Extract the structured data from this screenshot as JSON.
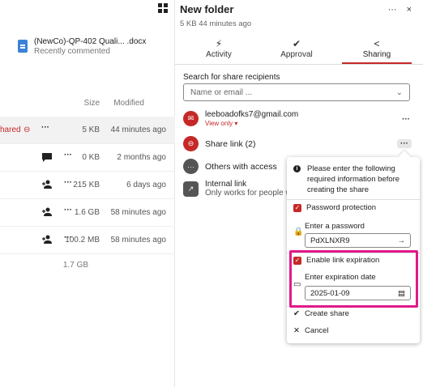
{
  "left": {
    "recent": {
      "name": "(NewCo)-QP-402 Quali... .docx",
      "status": "Recently commented"
    },
    "headers": {
      "size": "Size",
      "modified": "Modified"
    },
    "rows": [
      {
        "shared": "hared",
        "size": "5 KB",
        "modified": "44 minutes ago",
        "highlighted": true
      },
      {
        "size": "0 KB",
        "modified": "2 months ago"
      },
      {
        "size": "215 KB",
        "modified": "6 days ago"
      },
      {
        "size": "1.6 GB",
        "modified": "58 minutes ago"
      },
      {
        "size": "100.2 MB",
        "modified": "58 minutes ago"
      }
    ],
    "total": "1.7 GB"
  },
  "panel": {
    "title": "New folder",
    "subtitle": "5 KB 44 minutes ago",
    "more": "···",
    "close": "×",
    "tabs": [
      {
        "label": "Activity",
        "icon": "⚡"
      },
      {
        "label": "Approval",
        "icon": "✔"
      },
      {
        "label": "Sharing",
        "icon": "<"
      }
    ],
    "search_label": "Search for share recipients",
    "search_placeholder": "Name or email ...",
    "recipients": [
      {
        "name": "leeboadofks7@gmail.com",
        "perm": "View only ▾"
      },
      {
        "name": "Share link (2)"
      },
      {
        "name": "Others with access"
      },
      {
        "name": "Internal link",
        "sub": "Only works for people w"
      }
    ]
  },
  "popup": {
    "info": "Please enter the following required information before creating the share",
    "password_protection": "Password protection",
    "password_label": "Enter a password",
    "password_value": "PdXLNXR9",
    "enable_expiration": "Enable link expiration",
    "expiration_label": "Enter expiration date",
    "expiration_value": "2025-01-09",
    "create": "Create share",
    "cancel": "Cancel"
  },
  "colors": {
    "accent": "#c62828",
    "highlight": "#e1198b"
  }
}
